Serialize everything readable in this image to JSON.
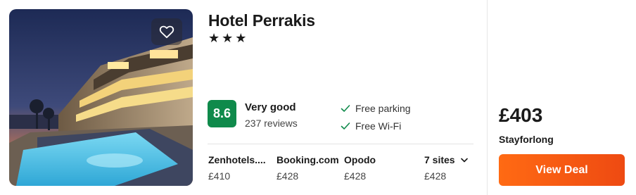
{
  "hotel": {
    "name": "Hotel Perrakis",
    "stars": "★★★"
  },
  "rating": {
    "score": "8.6",
    "label": "Very good",
    "reviews": "237 reviews",
    "badge_color": "#0f8a4b"
  },
  "amenities": [
    {
      "label": "Free parking",
      "icon": "check-icon"
    },
    {
      "label": "Free Wi-Fi",
      "icon": "check-icon"
    }
  ],
  "sites": [
    {
      "name": "Zenhotels....",
      "price": "£410"
    },
    {
      "name": "Booking.com",
      "price": "£428"
    },
    {
      "name": "Opodo",
      "price": "£428"
    }
  ],
  "more_sites": {
    "label": "7 sites",
    "price": "£428",
    "icon": "chevron-down-icon"
  },
  "deal": {
    "price": "£403",
    "provider": "Stayforlong",
    "button_label": "View Deal",
    "button_color": "#f25a15"
  },
  "favorite": {
    "icon": "heart-icon"
  }
}
